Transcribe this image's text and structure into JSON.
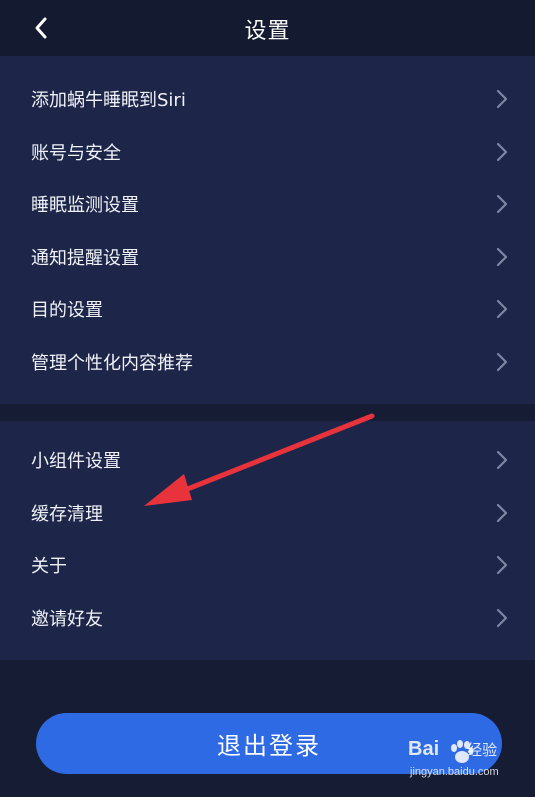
{
  "header": {
    "title": "设置",
    "back_icon": "chevron-left-icon"
  },
  "groups": [
    {
      "items": [
        {
          "label": "添加蜗牛睡眠到Siri",
          "icon": "chevron-right-icon"
        },
        {
          "label": "账号与安全",
          "icon": "chevron-right-icon"
        },
        {
          "label": "睡眠监测设置",
          "icon": "chevron-right-icon"
        },
        {
          "label": "通知提醒设置",
          "icon": "chevron-right-icon"
        },
        {
          "label": "目的设置",
          "icon": "chevron-right-icon"
        },
        {
          "label": "管理个性化内容推荐",
          "icon": "chevron-right-icon"
        }
      ]
    },
    {
      "items": [
        {
          "label": "小组件设置",
          "icon": "chevron-right-icon"
        },
        {
          "label": "缓存清理",
          "icon": "chevron-right-icon"
        },
        {
          "label": "关于",
          "icon": "chevron-right-icon"
        },
        {
          "label": "邀请好友",
          "icon": "chevron-right-icon"
        }
      ]
    }
  ],
  "logout_button": {
    "label": "退出登录"
  },
  "annotation": {
    "arrow_color": "#e8323c",
    "points_to": "缓存清理"
  },
  "watermark": {
    "brand": "Bai",
    "brand_suffix": "经验",
    "url": "jingyan.baidu.com"
  },
  "colors": {
    "background": "#161c34",
    "header": "#141a2f",
    "group": "#1d2649",
    "button": "#2f6ae5",
    "chevron": "#7f86a3"
  }
}
